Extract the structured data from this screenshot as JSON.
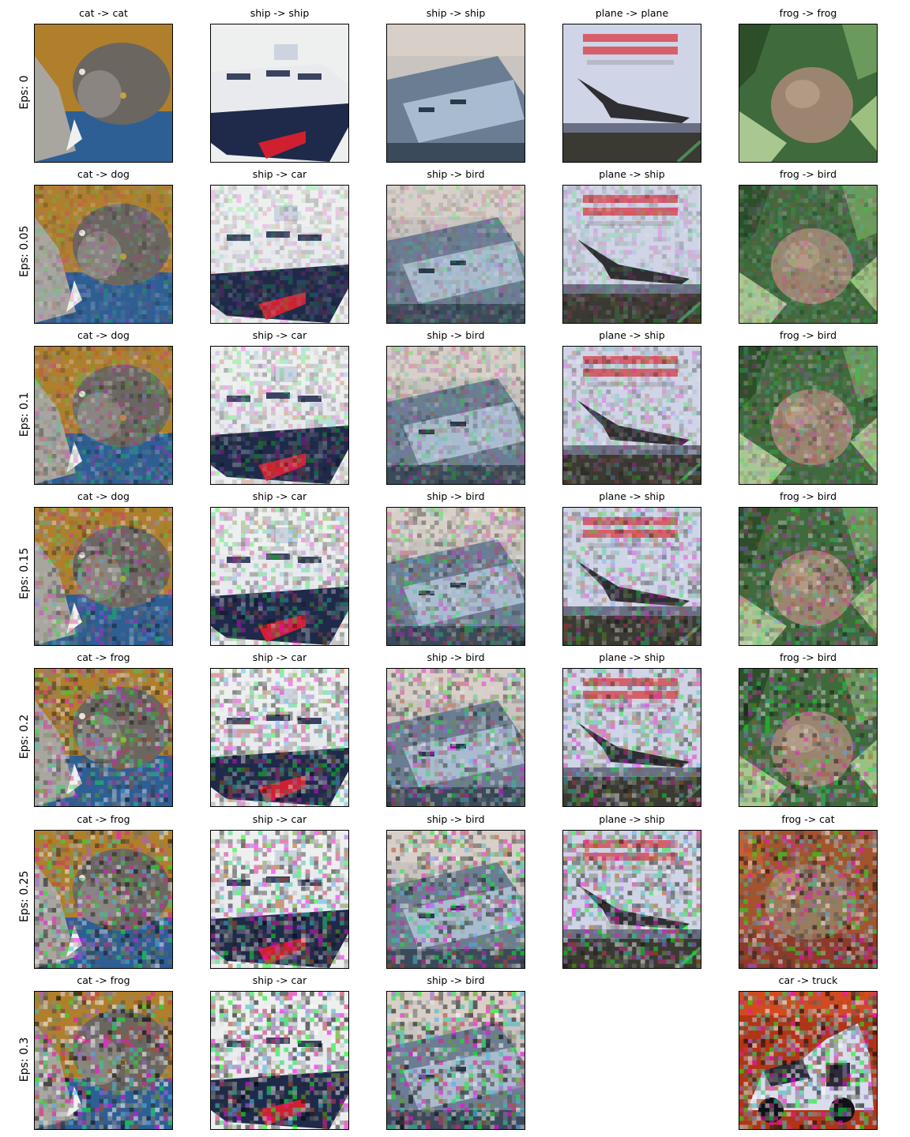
{
  "rows": [
    {
      "label": "Eps: 0",
      "cells": [
        "cat -> cat",
        "ship -> ship",
        "ship -> ship",
        "plane -> plane",
        "frog -> frog"
      ]
    },
    {
      "label": "Eps: 0.05",
      "cells": [
        "cat -> dog",
        "ship -> car",
        "ship -> bird",
        "plane -> ship",
        "frog -> bird"
      ]
    },
    {
      "label": "Eps: 0.1",
      "cells": [
        "cat -> dog",
        "ship -> car",
        "ship -> bird",
        "plane -> ship",
        "frog -> bird"
      ]
    },
    {
      "label": "Eps: 0.15",
      "cells": [
        "cat -> dog",
        "ship -> car",
        "ship -> bird",
        "plane -> ship",
        "frog -> bird"
      ]
    },
    {
      "label": "Eps: 0.2",
      "cells": [
        "cat -> frog",
        "ship -> car",
        "ship -> bird",
        "plane -> ship",
        "frog -> bird"
      ]
    },
    {
      "label": "Eps: 0.25",
      "cells": [
        "cat -> frog",
        "ship -> car",
        "ship -> bird",
        "plane -> ship",
        "frog -> cat"
      ]
    },
    {
      "label": "Eps: 0.3",
      "cells": [
        "cat -> frog",
        "ship -> car",
        "ship -> bird",
        null,
        "car -> truck"
      ]
    }
  ],
  "images": {
    "cat": "cat-image",
    "ship1": "ship-image",
    "ship2": "ship-image",
    "plane": "plane-image",
    "frog": "frog-image",
    "frog_red": "frog-image",
    "car": "car-image"
  }
}
